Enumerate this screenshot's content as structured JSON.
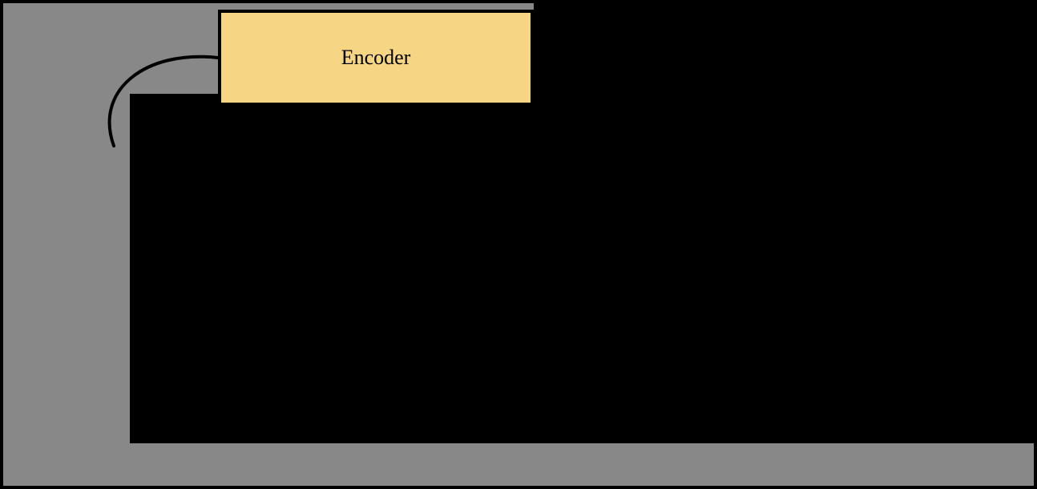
{
  "diagram": {
    "encoder": {
      "label": "Encoder"
    }
  }
}
